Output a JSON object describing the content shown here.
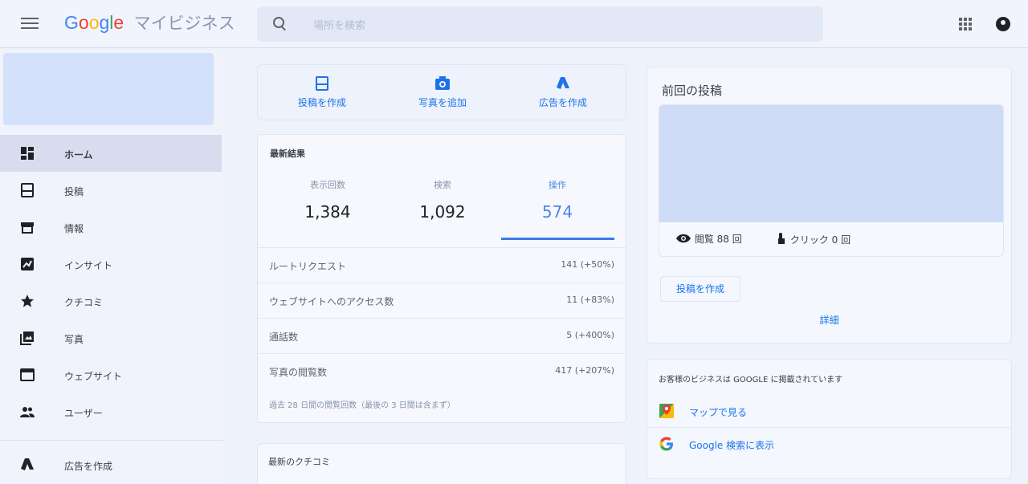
{
  "header": {
    "logo_google": [
      "G",
      "o",
      "o",
      "g",
      "l",
      "e"
    ],
    "product_name": "マイビジネス",
    "search_placeholder": "場所を検索"
  },
  "sidebar": {
    "items": [
      {
        "label": "ホーム",
        "icon": "dashboard-icon",
        "active": true
      },
      {
        "label": "投稿",
        "icon": "post-icon"
      },
      {
        "label": "情報",
        "icon": "storefront-icon"
      },
      {
        "label": "インサイト",
        "icon": "insights-icon"
      },
      {
        "label": "クチコミ",
        "icon": "star-icon"
      },
      {
        "label": "写真",
        "icon": "photos-icon"
      },
      {
        "label": "ウェブサイト",
        "icon": "website-icon"
      },
      {
        "label": "ユーザー",
        "icon": "users-icon"
      },
      {
        "label": "広告を作成",
        "icon": "google-ads-icon"
      }
    ]
  },
  "quick_actions": {
    "items": [
      {
        "label": "投稿を作成",
        "icon": "post-icon"
      },
      {
        "label": "写真を追加",
        "icon": "camera-icon"
      },
      {
        "label": "広告を作成",
        "icon": "google-ads-icon"
      }
    ]
  },
  "performance": {
    "title": "最新結果",
    "stats": [
      {
        "label": "表示回数",
        "value": "1,384"
      },
      {
        "label": "検索",
        "value": "1,092"
      },
      {
        "label": "操作",
        "value": "574"
      }
    ],
    "metrics": [
      {
        "label": "ルートリクエスト",
        "value": "141 (+50%)"
      },
      {
        "label": "ウェブサイトへのアクセス数",
        "value": "11 (+83%)"
      },
      {
        "label": "通話数",
        "value": "5 (+400%)"
      },
      {
        "label": "写真の閲覧数",
        "value": "417 (+207%)"
      }
    ],
    "footnote": "過去 28 日間の閲覧回数（最後の 3 日間は含まず）"
  },
  "reviews": {
    "title": "最新のクチコミ"
  },
  "last_post": {
    "title": "前回の投稿",
    "views": "閲覧 88 回",
    "clicks": "クリック 0 回",
    "create_button": "投稿を作成",
    "details_link": "詳細"
  },
  "google_presence": {
    "title": "お客様のビジネスは GOOGLE に掲載されています",
    "maps_link": "マップで見る",
    "search_link": "Google 検索に表示"
  },
  "colors": {
    "accent": "#1a73e8",
    "active_stat": "#4a86e8",
    "banner": "#d3e1fb"
  }
}
